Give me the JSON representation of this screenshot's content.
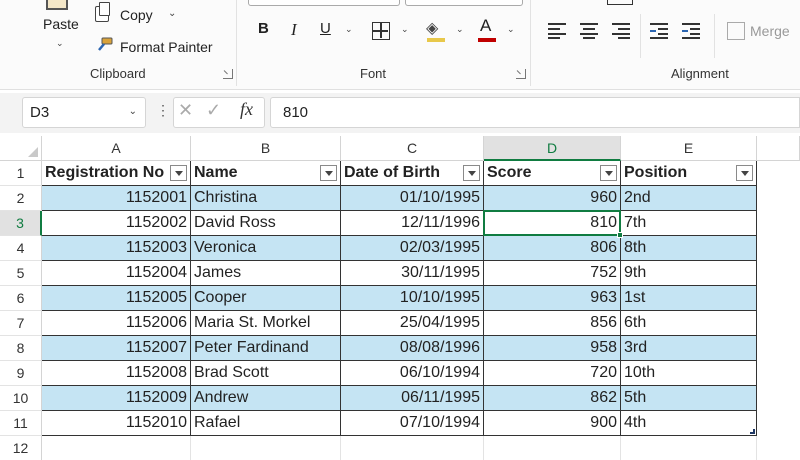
{
  "ribbon": {
    "clipboard": {
      "paste_label": "Paste",
      "copy_label": "Copy",
      "format_painter_label": "Format Painter",
      "group_label": "Clipboard"
    },
    "font": {
      "bold_label": "B",
      "italic_label": "I",
      "underline_label": "U",
      "font_color_label": "A",
      "group_label": "Font",
      "fill_color": "#e8c84a",
      "font_color": "#c00000"
    },
    "alignment": {
      "group_label": "Alignment",
      "merge_label": "Merge"
    }
  },
  "formula_bar": {
    "name_box": "D3",
    "fx_label": "fx",
    "formula": "810"
  },
  "grid": {
    "columns": [
      "A",
      "B",
      "C",
      "D",
      "E"
    ],
    "active_column": "D",
    "row_numbers": [
      "1",
      "2",
      "3",
      "4",
      "5",
      "6",
      "7",
      "8",
      "9",
      "10",
      "11",
      "12"
    ],
    "active_row": "3",
    "headers": [
      "Registration No",
      "Name",
      "Date of Birth",
      "Score",
      "Position"
    ],
    "rows": [
      [
        "1152001",
        "Christina",
        "01/10/1995",
        "960",
        "2nd"
      ],
      [
        "1152002",
        "David Ross",
        "12/11/1996",
        "810",
        "7th"
      ],
      [
        "1152003",
        "Veronica",
        "02/03/1995",
        "806",
        "8th"
      ],
      [
        "1152004",
        "James",
        "30/11/1995",
        "752",
        "9th"
      ],
      [
        "1152005",
        "Cooper",
        "10/10/1995",
        "963",
        "1st"
      ],
      [
        "1152006",
        "Maria St. Morkel",
        "25/04/1995",
        "856",
        "6th"
      ],
      [
        "1152007",
        "Peter Fardinand",
        "08/08/1996",
        "958",
        "3rd"
      ],
      [
        "1152008",
        "Brad Scott",
        "06/10/1994",
        "720",
        "10th"
      ],
      [
        "1152009",
        "Andrew",
        "06/11/1995",
        "862",
        "5th"
      ],
      [
        "1152010",
        "Rafael",
        "07/10/1994",
        "900",
        "4th"
      ]
    ],
    "band_color": "#c5e4f3",
    "accent_color": "#107c41"
  }
}
